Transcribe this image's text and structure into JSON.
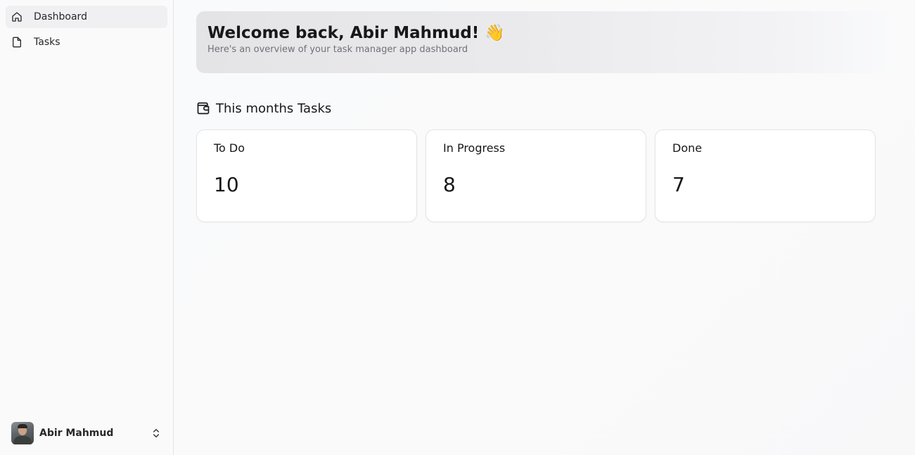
{
  "sidebar": {
    "items": [
      {
        "label": "Dashboard",
        "icon": "home-icon",
        "active": true
      },
      {
        "label": "Tasks",
        "icon": "file-icon",
        "active": false
      }
    ],
    "user": {
      "name": "Abir Mahmud"
    }
  },
  "main": {
    "welcome": {
      "title": "Welcome back, Abir Mahmud! 👋",
      "subtitle": "Here's an overview of your task manager app dashboard"
    },
    "section_title": "This months Tasks",
    "cards": [
      {
        "label": "To Do",
        "value": "10"
      },
      {
        "label": "In Progress",
        "value": "8"
      },
      {
        "label": "Done",
        "value": "7"
      }
    ]
  },
  "colors": {
    "sidebar_bg": "#fafafa",
    "active_item_bg": "#f0f0f2",
    "border": "#e4e4e7",
    "muted_text": "#71717a"
  }
}
